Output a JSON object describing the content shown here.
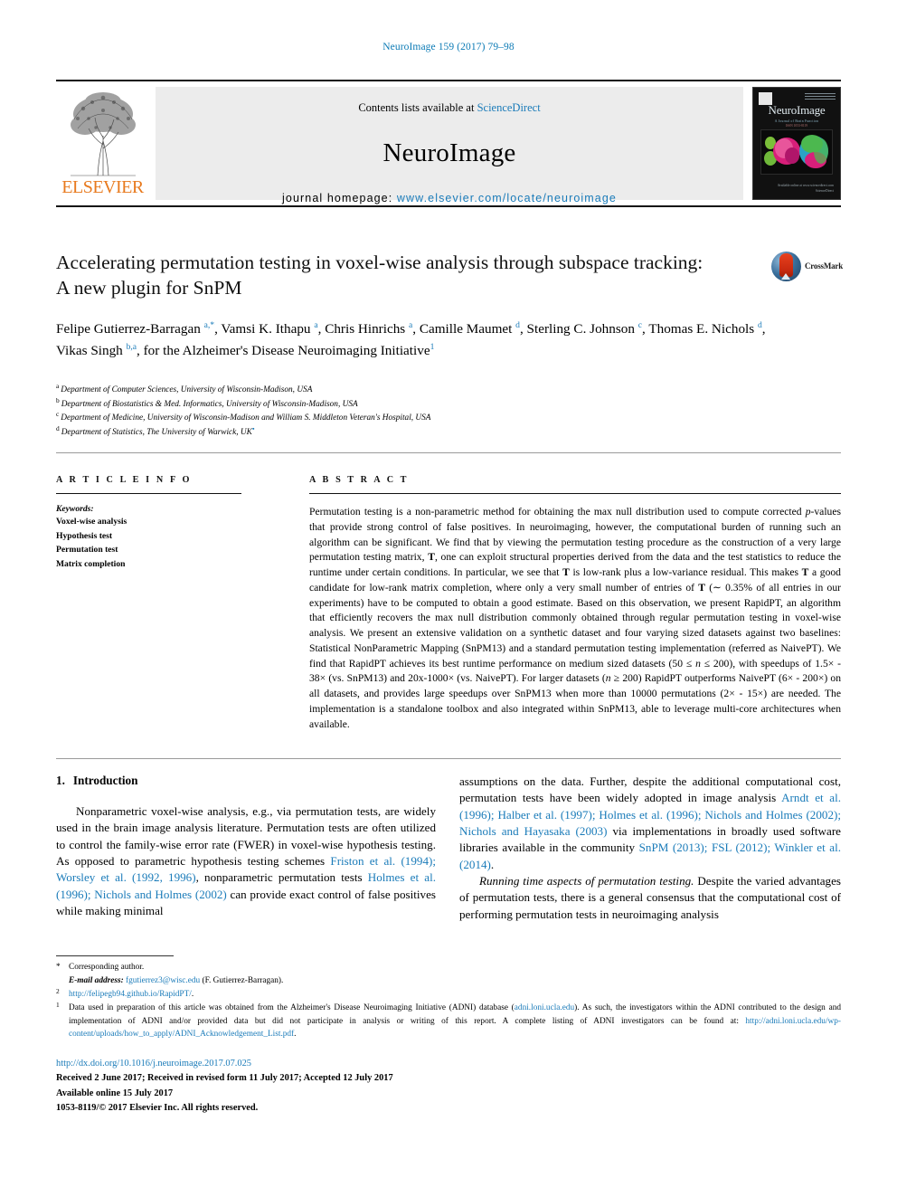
{
  "running_head": "NeuroImage 159 (2017) 79–98",
  "masthead": {
    "contents_prefix": "Contents lists available at ",
    "contents_link": "ScienceDirect",
    "journal_name": "NeuroImage",
    "homepage_prefix": "journal homepage: ",
    "homepage_url": "www.elsevier.com/locate/neuroimage",
    "publisher": "ELSEVIER",
    "cover": {
      "title": "NeuroImage",
      "subtitle": "A Journal of Brain Function",
      "subtitle2": "ISSN 1053-8119",
      "footer_line1": "Available online at www.sciencedirect.com",
      "footer_line2": "ScienceDirect"
    }
  },
  "article": {
    "title": "Accelerating permutation testing in voxel-wise analysis through subspace tracking: A new plugin for SnPM",
    "crossmark_label": "CrossMark",
    "authors_html": "Felipe Gutierrez-Barragan <sup>a,*</sup>, Vamsi K. Ithapu <sup>a</sup>, Chris Hinrichs <sup>a</sup>, Camille Maumet <sup>d</sup>, Sterling C. Johnson <sup>c</sup>, Thomas E. Nichols <sup>d</sup>, Vikas Singh <sup>b,a</sup>, for the Alzheimer's Disease Neuroimaging Initiative<sup>1</sup>",
    "affiliations": [
      {
        "mark": "a",
        "text": "Department of Computer Sciences, University of Wisconsin-Madison, USA"
      },
      {
        "mark": "b",
        "text": "Department of Biostatistics & Med. Informatics, University of Wisconsin-Madison, USA"
      },
      {
        "mark": "c",
        "text": "Department of Medicine, University of Wisconsin-Madison and William S. Middleton Veteran's Hospital, USA"
      },
      {
        "mark": "d",
        "text": "Department of Statistics, The University of Warwick, UK"
      }
    ]
  },
  "article_info": {
    "heading": "A R T I C L E  I N F O",
    "keywords_label": "Keywords:",
    "keywords": [
      "Voxel-wise analysis",
      "Hypothesis test",
      "Permutation test",
      "Matrix completion"
    ]
  },
  "abstract": {
    "heading": "A B S T R A C T",
    "text_html": "Permutation testing is a non-parametric method for obtaining the max null distribution used to compute corrected <i>p</i>-values that provide strong control of false positives. In neuroimaging, however, the computational burden of running such an algorithm can be significant. We find that by viewing the permutation testing procedure as the construction of a very large permutation testing matrix, <b>T</b>, one can exploit structural properties derived from the data and the test statistics to reduce the runtime under certain conditions. In particular, we see that <b>T</b> is low-rank plus a low-variance residual. This makes <b>T</b> a good candidate for low-rank matrix completion, where only a very small number of entries of <b>T</b> (∼ 0.35% of all entries in our experiments) have to be computed to obtain a good estimate. Based on this observation, we present RapidPT, an algorithm that efficiently recovers the max null distribution commonly obtained through regular permutation testing in voxel-wise analysis. We present an extensive validation on a synthetic dataset and four varying sized datasets against two baselines: Statistical NonParametric Mapping (SnPM13) and a standard permutation testing implementation (referred as NaivePT). We find that RapidPT achieves its best runtime performance on medium sized datasets (50 ≤ <i>n</i> ≤ 200), with speedups of 1.5× - 38× (vs. SnPM13) and 20x-1000× (vs. NaivePT). For larger datasets (<i>n</i> ≥ 200) RapidPT outperforms NaivePT (6× - 200×) on all datasets, and provides large speedups over SnPM13 when more than 10000 permutations (2× - 15×) are needed. The implementation is a standalone toolbox and also integrated within SnPM13, able to leverage multi-core architectures when available."
  },
  "introduction": {
    "number": "1.",
    "heading": "Introduction",
    "left_para1_html": "Nonparametric voxel-wise analysis, e.g., via permutation tests, are widely used in the brain image analysis literature. Permutation tests are often utilized to control the family-wise error rate (FWER) in voxel-wise hypothesis testing. As opposed to parametric hypothesis testing schemes <span class=\"cit\">Friston et al. (1994); Worsley et al. (1992, 1996)</span>, nonparametric permutation tests <span class=\"cit\">Holmes et al. (1996); Nichols and Holmes (2002)</span> can provide exact control of false positives while making minimal",
    "right_para1_html": "assumptions on the data. Further, despite the additional computational cost, permutation tests have been widely adopted in image analysis <span class=\"cit\">Arndt et al. (1996); Halber et al. (1997); Holmes et al. (1996); Nichols and Holmes (2002); Nichols and Hayasaka (2003)</span> via implementations in broadly used software libraries available in the community <span class=\"cit\">SnPM (2013); FSL (2012); Winkler et al. (2014)</span>.",
    "right_para2_html": "<span class=\"it\">Running time aspects of permutation testing.</span> Despite the varied advantages of permutation tests, there is a general consensus that the computational cost of performing permutation tests in neuroimaging analysis"
  },
  "footnotes": {
    "corresponding_mark": "*",
    "corresponding_text": "Corresponding author.",
    "email_label": "E-mail address:",
    "email_link": "fgutierrez3@wisc.edu",
    "email_suffix": " (F. Gutierrez-Barragan).",
    "fn2_mark": "2",
    "fn2_link": "http://felipegb94.github.io/RapidPT/",
    "fn2_suffix": ".",
    "fn1_mark": "1",
    "fn1_html": "Data used in preparation of this article was obtained from the Alzheimer's Disease Neuroimaging Initiative (ADNI) database (<span class=\"link\">adni.loni.ucla.edu</span>). As such, the investigators within the ADNI contributed to the design and implementation of ADNI and/or provided data but did not participate in analysis or writing of this report. A complete listing of ADNI investigators can be found at: <span class=\"link\">http://adni.loni.ucla.edu/wp-content/uploads/how_to_apply/ADNI_Acknowledgement_List.pdf</span>."
  },
  "publication": {
    "doi_url": "http://dx.doi.org/10.1016/j.neuroimage.2017.07.025",
    "history": "Received 2 June 2017; Received in revised form 11 July 2017; Accepted 12 July 2017",
    "available": "Available online 15 July 2017",
    "copyright": "1053-8119/© 2017 Elsevier Inc. All rights reserved."
  },
  "colors": {
    "link_blue": "#1a7bb9",
    "elsevier_orange": "#e87a1e",
    "masthead_gray": "#ececec"
  }
}
